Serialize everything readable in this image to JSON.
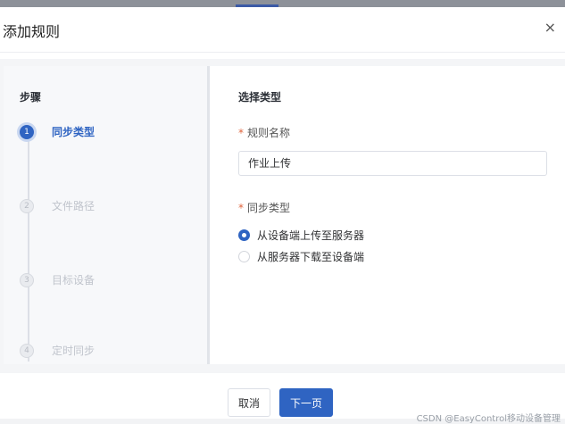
{
  "dialog": {
    "title": "添加规则",
    "close_icon": "×"
  },
  "steps": {
    "heading": "步骤",
    "items": [
      {
        "number": "1",
        "label": "同步类型",
        "state": "active"
      },
      {
        "number": "2",
        "label": "文件路径",
        "state": "inactive"
      },
      {
        "number": "3",
        "label": "目标设备",
        "state": "inactive"
      },
      {
        "number": "4",
        "label": "定时同步",
        "state": "inactive"
      }
    ]
  },
  "form": {
    "section_title": "选择类型",
    "required_mark": "*",
    "rule_name_label": "规则名称",
    "rule_name_value": "作业上传",
    "sync_type_label": "同步类型",
    "options": [
      {
        "label": "从设备端上传至服务器",
        "checked": true
      },
      {
        "label": "从服务器下载至设备端",
        "checked": false
      }
    ]
  },
  "footer": {
    "cancel_label": "取消",
    "next_label": "下一页"
  },
  "watermark": "CSDN @EasyControl移动设备管理",
  "colors": {
    "accent": "#2f64c2",
    "required": "#e0643c",
    "inactive": "#c0c4cc"
  }
}
